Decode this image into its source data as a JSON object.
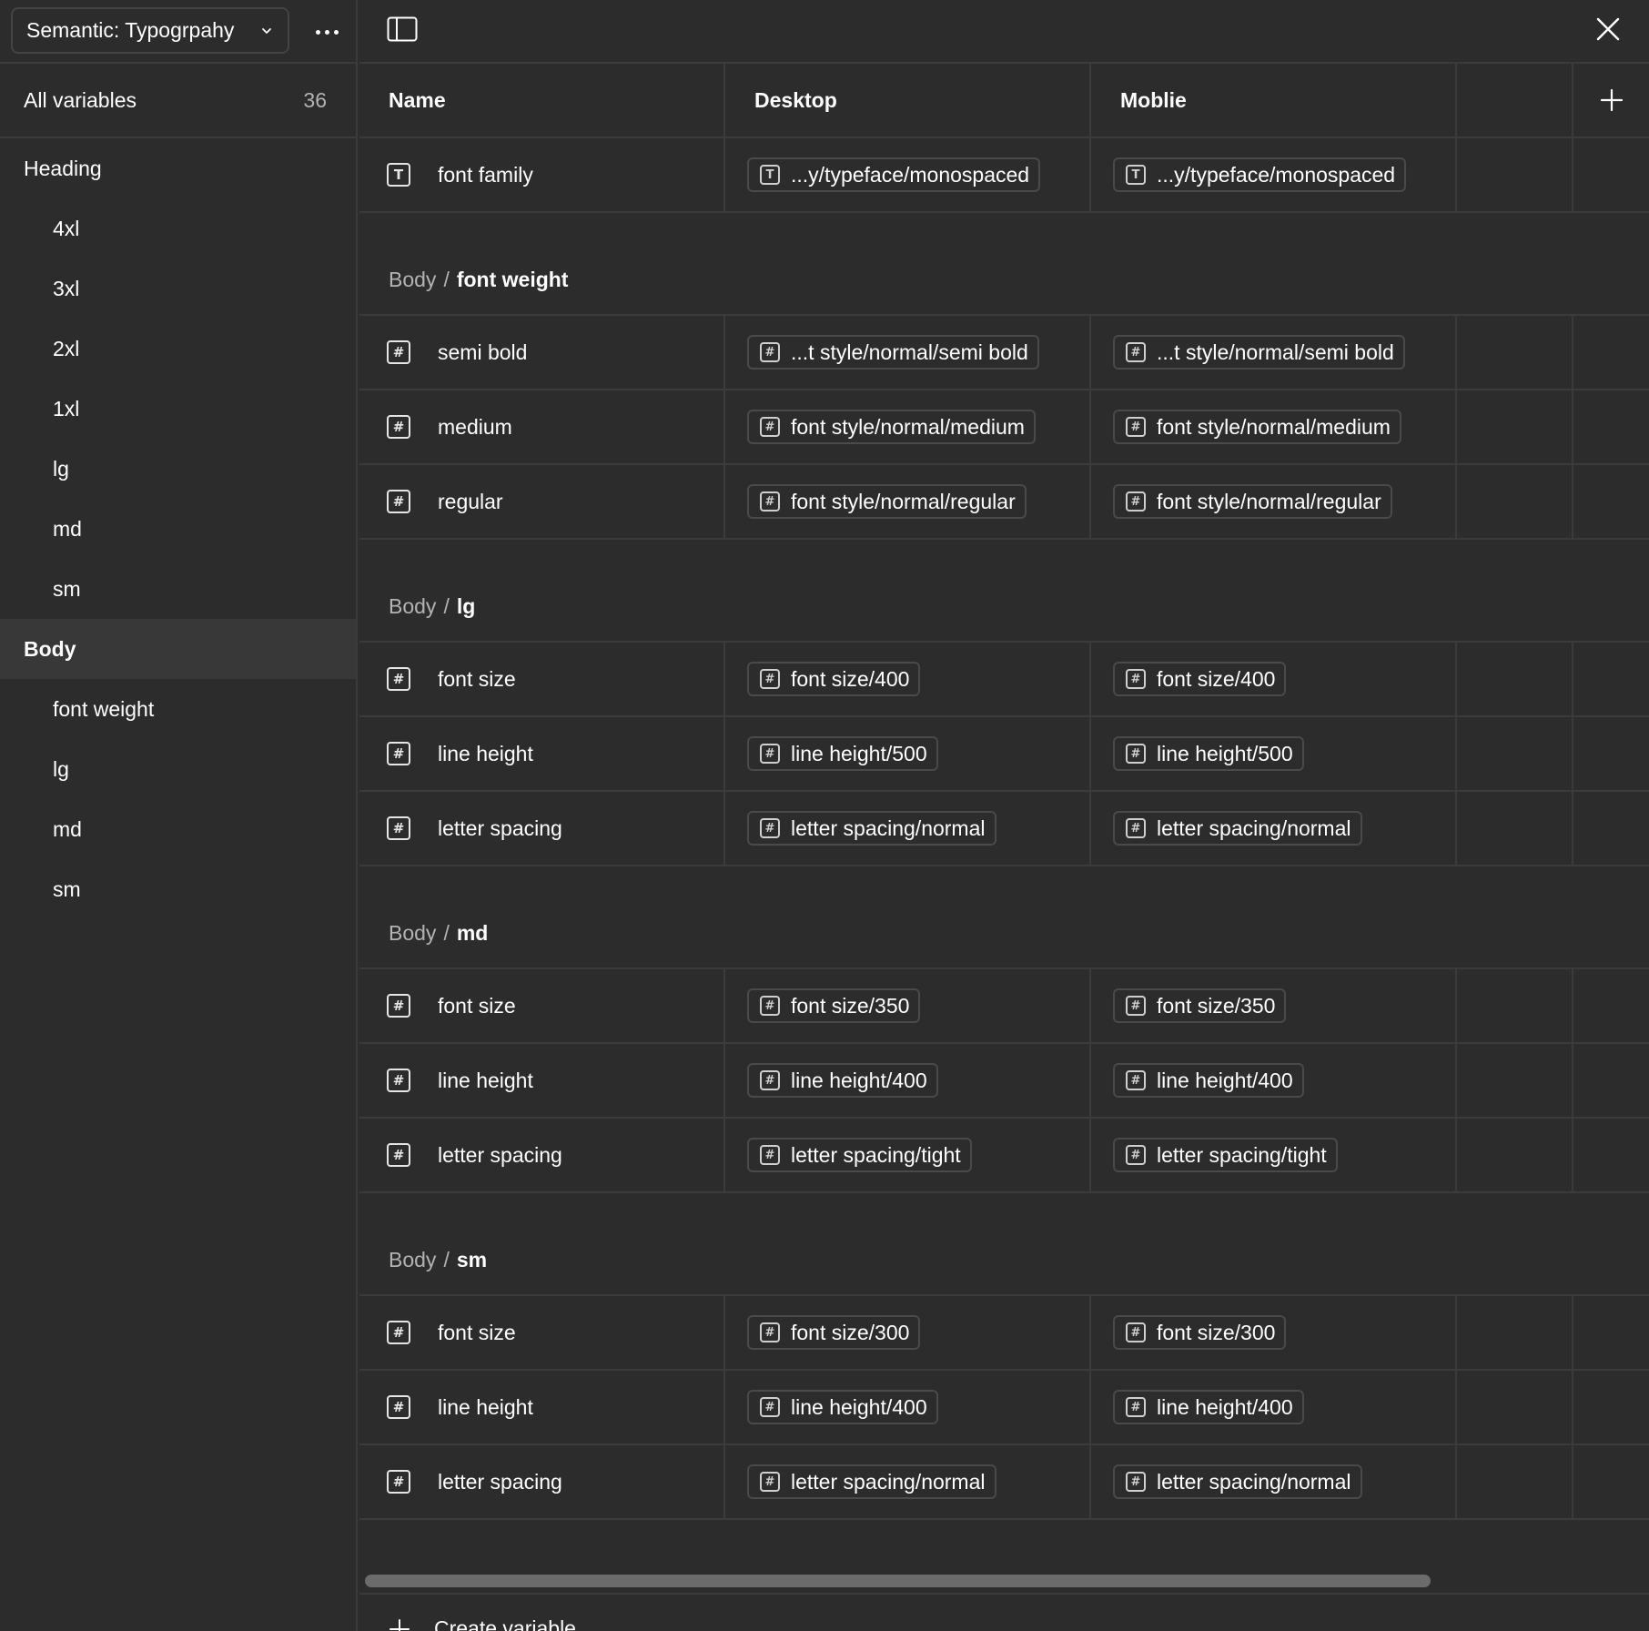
{
  "sidebar": {
    "collection": "Semantic: Typogrpahy",
    "all_variables_label": "All variables",
    "all_variables_count": "36",
    "groups": [
      {
        "label": "Heading",
        "child": false,
        "active": false
      },
      {
        "label": "4xl",
        "child": true,
        "active": false
      },
      {
        "label": "3xl",
        "child": true,
        "active": false
      },
      {
        "label": "2xl",
        "child": true,
        "active": false
      },
      {
        "label": "1xl",
        "child": true,
        "active": false
      },
      {
        "label": "lg",
        "child": true,
        "active": false
      },
      {
        "label": "md",
        "child": true,
        "active": false
      },
      {
        "label": "sm",
        "child": true,
        "active": false
      },
      {
        "label": "Body",
        "child": false,
        "active": true
      },
      {
        "label": "font weight",
        "child": true,
        "active": false
      },
      {
        "label": "lg",
        "child": true,
        "active": false
      },
      {
        "label": "md",
        "child": true,
        "active": false
      },
      {
        "label": "sm",
        "child": true,
        "active": false
      }
    ]
  },
  "table": {
    "columns": {
      "name": "Name",
      "desktop": "Desktop",
      "mobile": "Moblie"
    },
    "rows": [
      {
        "kind": "var",
        "icon": "T",
        "name": "font family",
        "desktop": "...y/typeface/monospaced",
        "mobile": "...y/typeface/monospaced"
      },
      {
        "kind": "group",
        "parent": "Body",
        "sep": "/",
        "leaf": "font weight"
      },
      {
        "kind": "var",
        "icon": "#",
        "name": "semi bold",
        "desktop": "...t style/normal/semi bold",
        "mobile": "...t style/normal/semi bold"
      },
      {
        "kind": "var",
        "icon": "#",
        "name": "medium",
        "desktop": "font style/normal/medium",
        "mobile": "font style/normal/medium"
      },
      {
        "kind": "var",
        "icon": "#",
        "name": "regular",
        "desktop": "font style/normal/regular",
        "mobile": "font style/normal/regular"
      },
      {
        "kind": "group",
        "parent": "Body",
        "sep": "/",
        "leaf": "lg"
      },
      {
        "kind": "var",
        "icon": "#",
        "name": "font size",
        "desktop": "font size/400",
        "mobile": "font size/400"
      },
      {
        "kind": "var",
        "icon": "#",
        "name": "line height",
        "desktop": "line height/500",
        "mobile": "line height/500"
      },
      {
        "kind": "var",
        "icon": "#",
        "name": "letter spacing",
        "desktop": "letter spacing/normal",
        "mobile": "letter spacing/normal"
      },
      {
        "kind": "group",
        "parent": "Body",
        "sep": "/",
        "leaf": "md"
      },
      {
        "kind": "var",
        "icon": "#",
        "name": "font size",
        "desktop": "font size/350",
        "mobile": "font size/350"
      },
      {
        "kind": "var",
        "icon": "#",
        "name": "line height",
        "desktop": "line height/400",
        "mobile": "line height/400"
      },
      {
        "kind": "var",
        "icon": "#",
        "name": "letter spacing",
        "desktop": "letter spacing/tight",
        "mobile": "letter spacing/tight"
      },
      {
        "kind": "group",
        "parent": "Body",
        "sep": "/",
        "leaf": "sm"
      },
      {
        "kind": "var",
        "icon": "#",
        "name": "font size",
        "desktop": "font size/300",
        "mobile": "font size/300"
      },
      {
        "kind": "var",
        "icon": "#",
        "name": "line height",
        "desktop": "line height/400",
        "mobile": "line height/400"
      },
      {
        "kind": "var",
        "icon": "#",
        "name": "letter spacing",
        "desktop": "letter spacing/normal",
        "mobile": "letter spacing/normal"
      }
    ]
  },
  "footer": {
    "create_label": "Create variable"
  },
  "icons": {
    "collection_chevron": "chevron-down-icon",
    "more": "more-horizontal-icon",
    "panel_toggle": "sidebar-toggle-icon",
    "close": "close-icon",
    "add_column": "plus-icon",
    "string_type": "text-type-icon",
    "number_type": "number-type-icon"
  },
  "colors": {
    "background": "#2c2c2c",
    "border": "#3b3b3b",
    "active_row": "#383838",
    "muted_text": "#b3b3b3",
    "scrollbar": "#6b6b6b"
  }
}
